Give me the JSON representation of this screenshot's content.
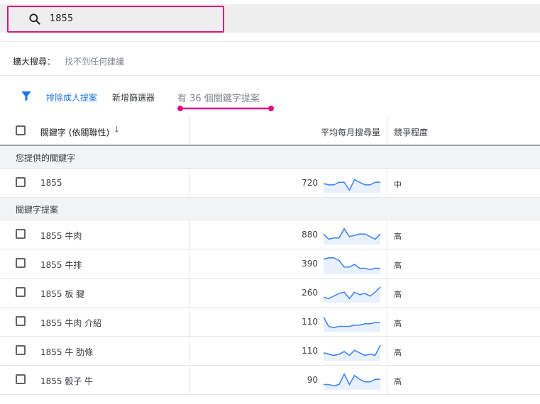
{
  "search": {
    "value": "1855"
  },
  "expand": {
    "label": "擴大搜尋：",
    "value": "找不到任何建議"
  },
  "toolbar": {
    "exclude_adult": "排除成人提案",
    "add_filter": "新增篩選器",
    "result_count": "有 36 個關鍵字提案"
  },
  "colors": {
    "accent": "#1a73e8",
    "highlight": "#e0117f"
  },
  "table": {
    "headers": {
      "keyword": "關鍵字 (依關聯性)",
      "sort_arrow": "↓",
      "volume": "平均每月搜尋量",
      "competition": "競爭程度"
    },
    "section_provided": "您提供的關鍵字",
    "section_ideas": "關鍵字提案",
    "provided": [
      {
        "keyword": "1855",
        "volume": "720",
        "competition": "中",
        "trend": [
          6,
          5,
          5,
          7,
          7,
          1,
          9,
          7,
          5,
          5,
          7,
          7
        ]
      }
    ],
    "ideas": [
      {
        "keyword": "1855 牛肉",
        "volume": "880",
        "competition": "高",
        "trend": [
          7,
          3,
          4,
          4,
          11,
          5,
          6,
          7,
          7,
          5,
          3,
          7
        ]
      },
      {
        "keyword": "1855 牛排",
        "volume": "390",
        "competition": "高",
        "trend": [
          10,
          11,
          11,
          9,
          4,
          4,
          6,
          3,
          3,
          2,
          3,
          3
        ]
      },
      {
        "keyword": "1855 板 腱",
        "volume": "260",
        "competition": "高",
        "trend": [
          3,
          2,
          4,
          6,
          7,
          2,
          7,
          5,
          6,
          4,
          7,
          11
        ]
      },
      {
        "keyword": "1855 牛肉 介紹",
        "volume": "110",
        "competition": "高",
        "trend": [
          10,
          3,
          2,
          3,
          3,
          3,
          4,
          4,
          5,
          5,
          6,
          6
        ]
      },
      {
        "keyword": "1855 牛 肋條",
        "volume": "110",
        "competition": "高",
        "trend": [
          5,
          4,
          3,
          4,
          6,
          3,
          7,
          5,
          3,
          4,
          3,
          11
        ]
      },
      {
        "keyword": "1855 骰子 牛",
        "volume": "90",
        "competition": "高",
        "trend": [
          3,
          3,
          2,
          3,
          11,
          3,
          10,
          7,
          5,
          5,
          7,
          7
        ]
      }
    ]
  }
}
